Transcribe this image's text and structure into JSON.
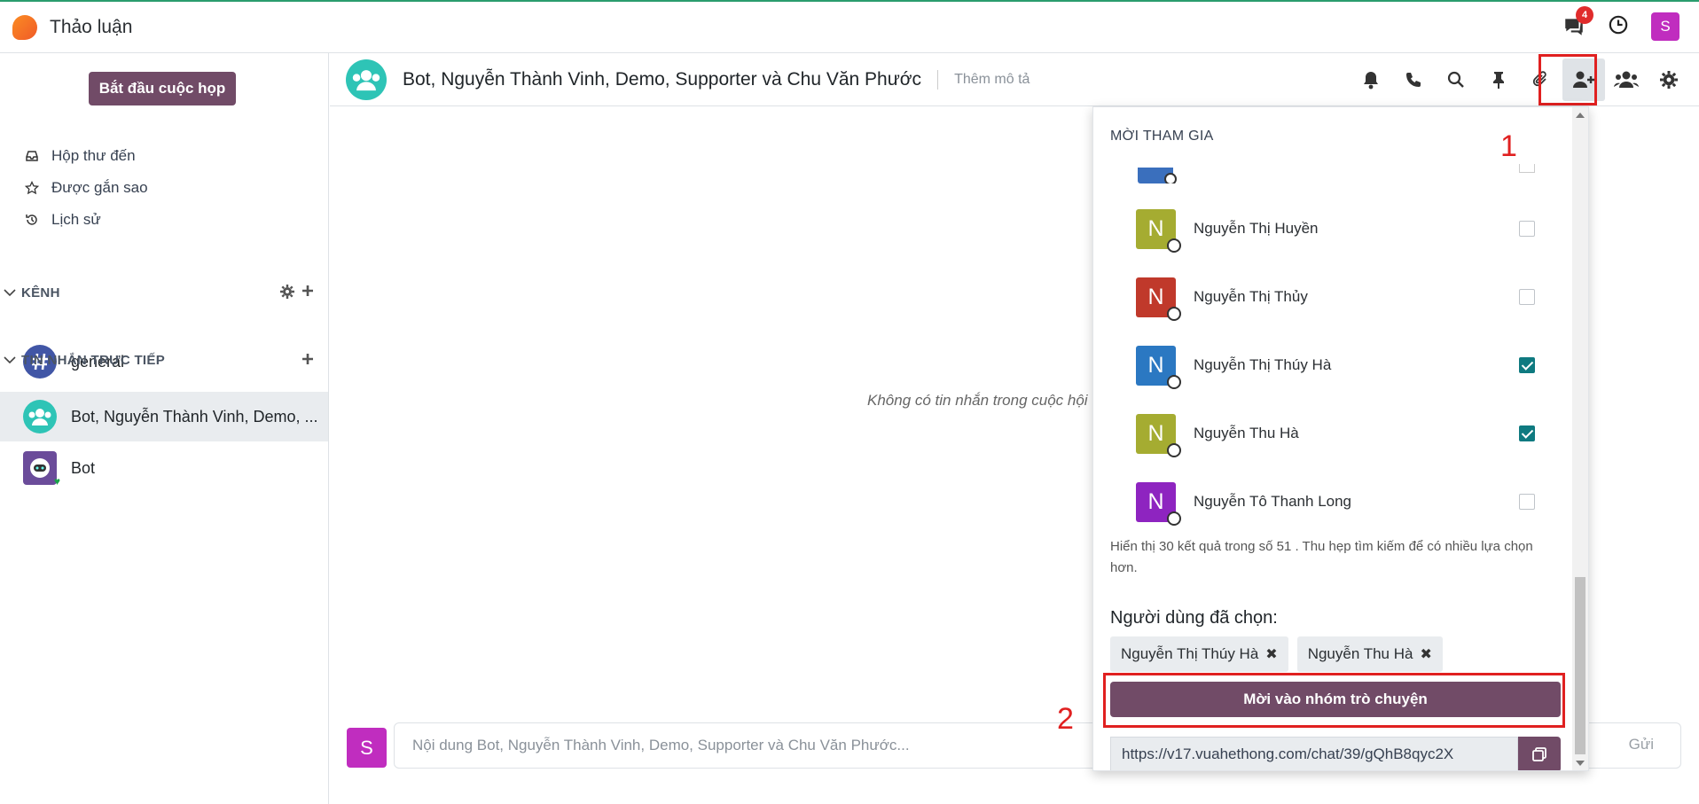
{
  "app": {
    "title": "Thảo luận",
    "chat_badge": "4",
    "user_initial": "S"
  },
  "sidebar": {
    "start_meeting": "Bắt đầu cuộc họp",
    "nav": [
      {
        "label": "Hộp thư đến",
        "icon": "inbox-icon"
      },
      {
        "label": "Được gắn sao",
        "icon": "star-icon"
      },
      {
        "label": "Lịch sử",
        "icon": "history-icon"
      }
    ],
    "channels_header": "KÊNH",
    "channels": [
      {
        "label": "general"
      }
    ],
    "dm_header": "TIN NHẮN TRỰC TIẾP",
    "dms": [
      {
        "label": "Bot, Nguyễn Thành Vinh, Demo, ..."
      },
      {
        "label": "Bot"
      }
    ]
  },
  "thread": {
    "title": "Bot, Nguyễn Thành Vinh, Demo, Supporter và Chu Văn Phước",
    "description_placeholder": "Thêm mô tả",
    "empty_message": "Không có tin nhắn trong cuộc hội",
    "composer_placeholder": "Nội dung Bot, Nguyễn Thành Vinh, Demo, Supporter và Chu Văn Phước...",
    "send_label": "Gửi",
    "composer_initial": "S"
  },
  "invite_panel": {
    "title": "MỜI THAM GIA",
    "users": [
      {
        "initial": "N",
        "name": "Nguyễn Thị Huyền",
        "color": "#a5ac31",
        "checked": false
      },
      {
        "initial": "N",
        "name": "Nguyễn Thị Thủy",
        "color": "#c0392b",
        "checked": false
      },
      {
        "initial": "N",
        "name": "Nguyễn Thị Thúy Hà",
        "color": "#2b78c2",
        "checked": true
      },
      {
        "initial": "N",
        "name": "Nguyễn Thu Hà",
        "color": "#a5ac31",
        "checked": true
      },
      {
        "initial": "N",
        "name": "Nguyễn Tô Thanh Long",
        "color": "#8e24c0",
        "checked": false
      }
    ],
    "hint": "Hiển thị 30 kết quả trong số 51 . Thu hẹp tìm kiếm để có nhiều lựa chọn hơn.",
    "selected_title": "Người dùng đã chọn:",
    "selected": [
      "Nguyễn Thị Thúy Hà",
      "Nguyễn Thu Hà"
    ],
    "invite_button": "Mời vào nhóm trò chuyện",
    "invite_link": "https://v17.vuahethong.com/chat/39/gQhB8qyc2X"
  },
  "annotations": {
    "step1": "1",
    "step2": "2"
  },
  "colors": {
    "primary": "#714b67",
    "checkbox": "#0f7a80",
    "highlight": "#e02020"
  }
}
